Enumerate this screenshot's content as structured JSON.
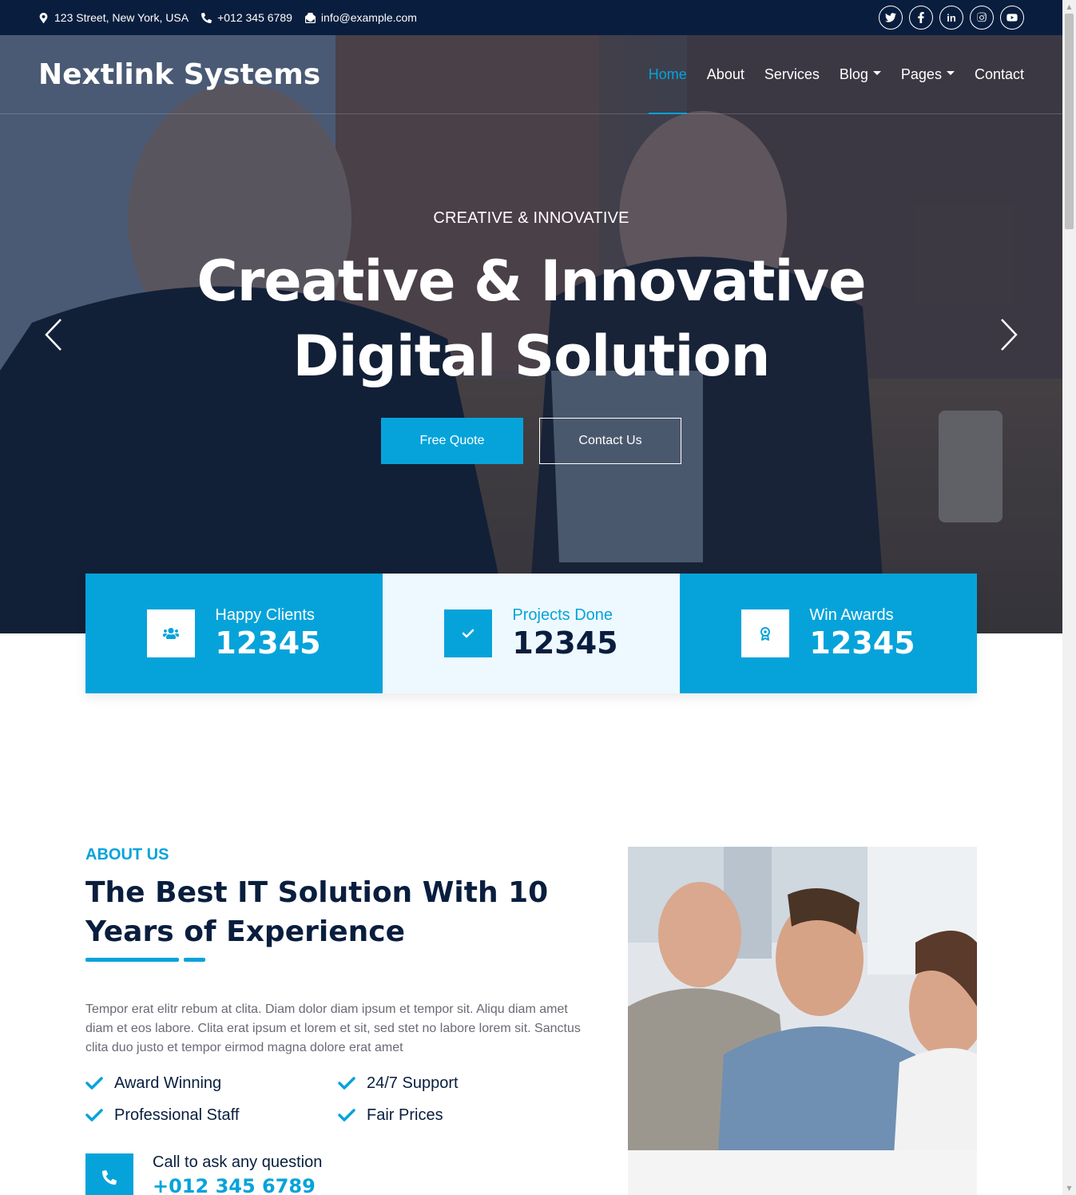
{
  "topbar": {
    "address": "123 Street, New York, USA",
    "phone": "+012 345 6789",
    "email": "info@example.com",
    "socials": [
      "twitter-icon",
      "facebook-icon",
      "linkedin-icon",
      "instagram-icon",
      "youtube-icon"
    ]
  },
  "navbar": {
    "brand": "Nextlink Systems",
    "links": [
      {
        "label": "Home",
        "active": true
      },
      {
        "label": "About"
      },
      {
        "label": "Services"
      },
      {
        "label": "Blog",
        "dropdown": true
      },
      {
        "label": "Pages",
        "dropdown": true
      },
      {
        "label": "Contact"
      }
    ]
  },
  "hero": {
    "subtitle": "Creative & Innovative",
    "title_line1": "Creative & Innovative",
    "title_line2": "Digital Solution",
    "primary_button": "Free Quote",
    "secondary_button": "Contact Us"
  },
  "stats": [
    {
      "label": "Happy Clients",
      "value": "12345",
      "icon": "users-icon"
    },
    {
      "label": "Projects Done",
      "value": "12345",
      "icon": "check-icon"
    },
    {
      "label": "Win Awards",
      "value": "12345",
      "icon": "award-icon"
    }
  ],
  "about": {
    "label": "About Us",
    "title": "The Best IT Solution With 10 Years of Experience",
    "text": "Tempor erat elitr rebum at clita. Diam dolor diam ipsum et tempor sit. Aliqu diam amet diam et eos labore. Clita erat ipsum et lorem et sit, sed stet no labore lorem sit. Sanctus clita duo justo et tempor eirmod magna dolore erat amet",
    "features": [
      "Award Winning",
      "24/7 Support",
      "Professional Staff",
      "Fair Prices"
    ],
    "call_label": "Call to ask any question",
    "call_number": "+012 345 6789"
  },
  "colors": {
    "primary": "#06a3da",
    "dark": "#091e3e",
    "light": "#eef9ff"
  }
}
